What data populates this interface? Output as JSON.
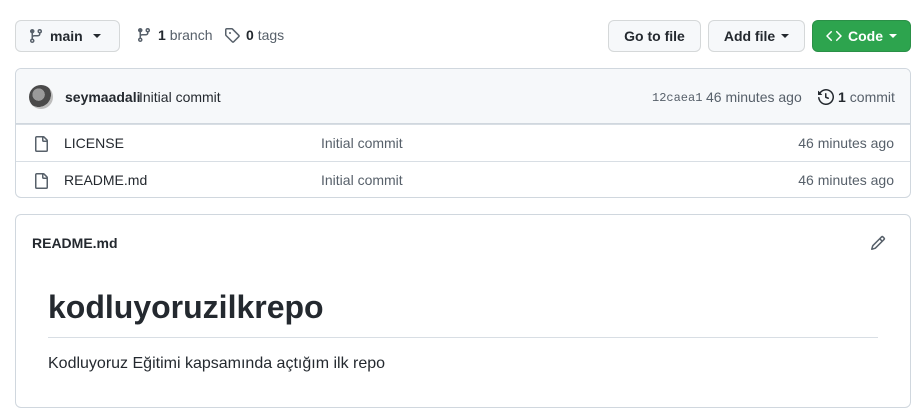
{
  "toolbar": {
    "branch_name": "main",
    "branch_count": "1",
    "branch_label": "branch",
    "tag_count": "0",
    "tag_label": "tags",
    "goto_label": "Go to file",
    "addfile_label": "Add file",
    "code_label": "Code",
    "code_color": "#2da44e"
  },
  "latest_commit": {
    "author": "seymaadali",
    "message": "Initial commit",
    "hash": "12caea1",
    "time": "46 minutes ago",
    "commit_count": "1",
    "commit_label": "commit"
  },
  "files": [
    {
      "name": "LICENSE",
      "message": "Initial commit",
      "time": "46 minutes ago",
      "icon": "file-icon"
    },
    {
      "name": "README.md",
      "message": "Initial commit",
      "time": "46 minutes ago",
      "icon": "file-icon"
    }
  ],
  "readme": {
    "filename": "README.md",
    "heading": "kodluyoruzilkrepo",
    "paragraph": "Kodluyoruz Eğitimi kapsamında açtığım ilk repo"
  }
}
